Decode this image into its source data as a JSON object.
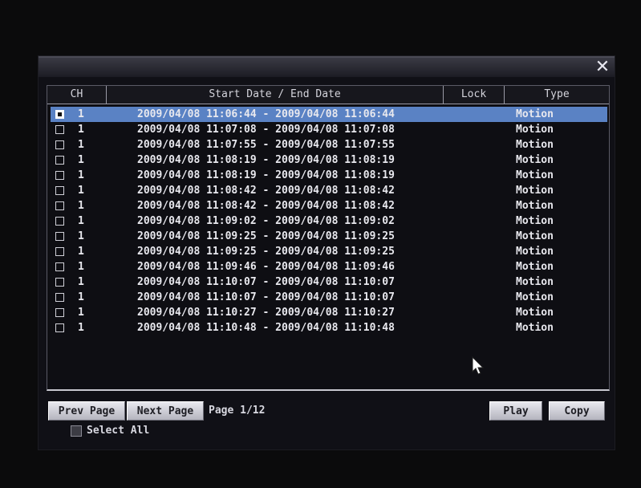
{
  "dialog": {
    "close_glyph": "✕"
  },
  "table": {
    "headers": {
      "ch": "CH",
      "date": "Start Date / End Date",
      "lock": "Lock",
      "type": "Type"
    },
    "rows": [
      {
        "ch": "1",
        "dates": "2009/04/08 11:06:44 - 2009/04/08 11:06:44",
        "lock": "",
        "type": "Motion",
        "selected": true
      },
      {
        "ch": "1",
        "dates": "2009/04/08 11:07:08 - 2009/04/08 11:07:08",
        "lock": "",
        "type": "Motion",
        "selected": false
      },
      {
        "ch": "1",
        "dates": "2009/04/08 11:07:55 - 2009/04/08 11:07:55",
        "lock": "",
        "type": "Motion",
        "selected": false
      },
      {
        "ch": "1",
        "dates": "2009/04/08 11:08:19 - 2009/04/08 11:08:19",
        "lock": "",
        "type": "Motion",
        "selected": false
      },
      {
        "ch": "1",
        "dates": "2009/04/08 11:08:19 - 2009/04/08 11:08:19",
        "lock": "",
        "type": "Motion",
        "selected": false
      },
      {
        "ch": "1",
        "dates": "2009/04/08 11:08:42 - 2009/04/08 11:08:42",
        "lock": "",
        "type": "Motion",
        "selected": false
      },
      {
        "ch": "1",
        "dates": "2009/04/08 11:08:42 - 2009/04/08 11:08:42",
        "lock": "",
        "type": "Motion",
        "selected": false
      },
      {
        "ch": "1",
        "dates": "2009/04/08 11:09:02 - 2009/04/08 11:09:02",
        "lock": "",
        "type": "Motion",
        "selected": false
      },
      {
        "ch": "1",
        "dates": "2009/04/08 11:09:25 - 2009/04/08 11:09:25",
        "lock": "",
        "type": "Motion",
        "selected": false
      },
      {
        "ch": "1",
        "dates": "2009/04/08 11:09:25 - 2009/04/08 11:09:25",
        "lock": "",
        "type": "Motion",
        "selected": false
      },
      {
        "ch": "1",
        "dates": "2009/04/08 11:09:46 - 2009/04/08 11:09:46",
        "lock": "",
        "type": "Motion",
        "selected": false
      },
      {
        "ch": "1",
        "dates": "2009/04/08 11:10:07 - 2009/04/08 11:10:07",
        "lock": "",
        "type": "Motion",
        "selected": false
      },
      {
        "ch": "1",
        "dates": "2009/04/08 11:10:07 - 2009/04/08 11:10:07",
        "lock": "",
        "type": "Motion",
        "selected": false
      },
      {
        "ch": "1",
        "dates": "2009/04/08 11:10:27 - 2009/04/08 11:10:27",
        "lock": "",
        "type": "Motion",
        "selected": false
      },
      {
        "ch": "1",
        "dates": "2009/04/08 11:10:48 - 2009/04/08 11:10:48",
        "lock": "",
        "type": "Motion",
        "selected": false
      }
    ]
  },
  "footer": {
    "prev_label": "Prev Page",
    "next_label": "Next Page",
    "page_label": "Page 1/12",
    "play_label": "Play",
    "copy_label": "Copy",
    "select_all_label": "Select All"
  },
  "colors": {
    "selected_row": "#5a82c4",
    "background": "#0b0b0c",
    "text": "#e8e8ee"
  },
  "icons": {
    "close": "close-icon",
    "pointer": "mouse-pointer-icon",
    "checkbox": "checkbox-icon"
  }
}
